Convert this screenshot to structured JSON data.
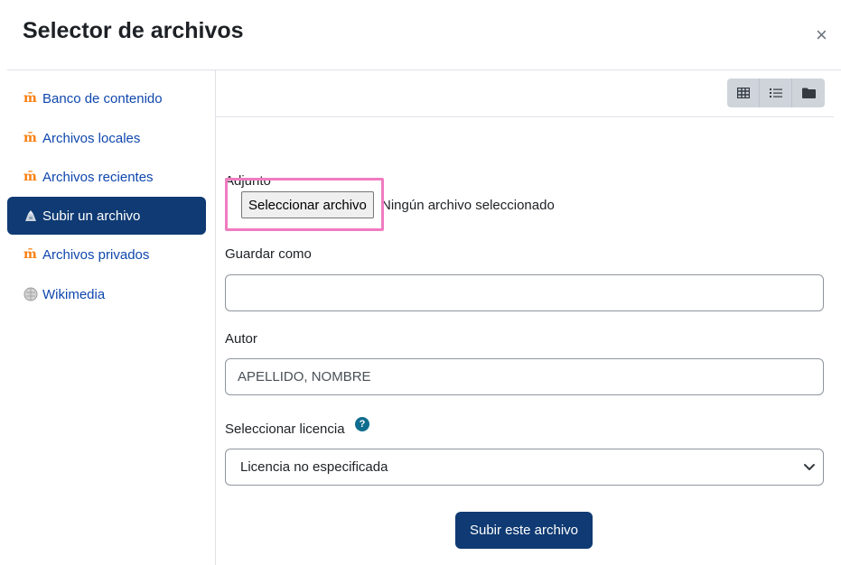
{
  "dialog": {
    "title": "Selector de archivos",
    "close_symbol": "×"
  },
  "sidebar": {
    "items": [
      {
        "label": "Banco de contenido",
        "icon": "moodle-icon",
        "active": false
      },
      {
        "label": "Archivos locales",
        "icon": "moodle-icon",
        "active": false
      },
      {
        "label": "Archivos recientes",
        "icon": "moodle-icon",
        "active": false
      },
      {
        "label": "Subir un archivo",
        "icon": "upload-icon",
        "active": true
      },
      {
        "label": "Archivos privados",
        "icon": "moodle-icon",
        "active": false
      },
      {
        "label": "Wikimedia",
        "icon": "wikimedia-icon",
        "active": false
      }
    ]
  },
  "toolbar": {
    "views": [
      "grid-view-icon",
      "list-view-icon",
      "folder-view-icon"
    ]
  },
  "form": {
    "attachment_label": "Adjunto",
    "file_button": "Seleccionar archivo",
    "file_status": "Ningún archivo seleccionado",
    "save_as_label": "Guardar como",
    "save_as_value": "",
    "author_label": "Autor",
    "author_placeholder": "APELLIDO, NOMBRE",
    "license_label": "Seleccionar licencia",
    "help_symbol": "?",
    "license_value": "Licencia no especificada",
    "submit_label": "Subir este archivo"
  },
  "colors": {
    "primary": "#0f3a73",
    "link": "#0f47ad",
    "highlight": "#f07cc0",
    "moodle_orange": "#f98012"
  }
}
